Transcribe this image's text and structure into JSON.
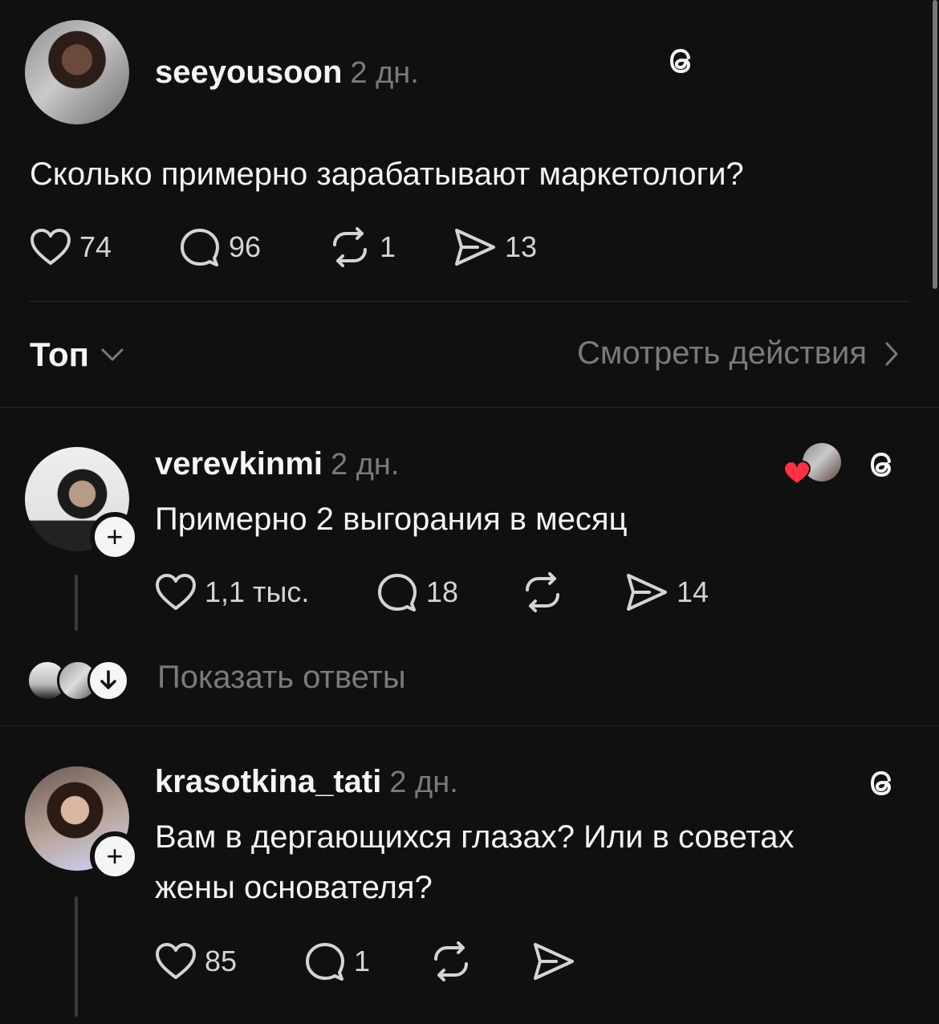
{
  "post": {
    "username": "seeyousoon",
    "time": "2 дн.",
    "text": "Сколько примерно зарабатывают маркетологи?",
    "stats": {
      "likes": "74",
      "comments": "96",
      "reposts": "1",
      "shares": "13"
    }
  },
  "sort_bar": {
    "sort_label": "Топ",
    "activity_label": "Смотреть действия"
  },
  "replies": [
    {
      "username": "verevkinmi",
      "time": "2 дн.",
      "text": "Примерно 2 выгорания в месяц",
      "stats": {
        "likes": "1,1 тыс.",
        "comments": "18",
        "shares": "14"
      },
      "show_replies_label": "Показать ответы"
    },
    {
      "username": "krasotkina_tati",
      "time": "2 дн.",
      "text_line1": "Вам в дергающихся глазах? Или в советах",
      "text_line2": "жены основателя?",
      "stats": {
        "likes": "85",
        "comments": "1"
      }
    }
  ],
  "colors": {
    "background": "#101010",
    "text": "#f3f5f7",
    "muted": "#7a7a7a",
    "like_red": "#ff3040"
  }
}
